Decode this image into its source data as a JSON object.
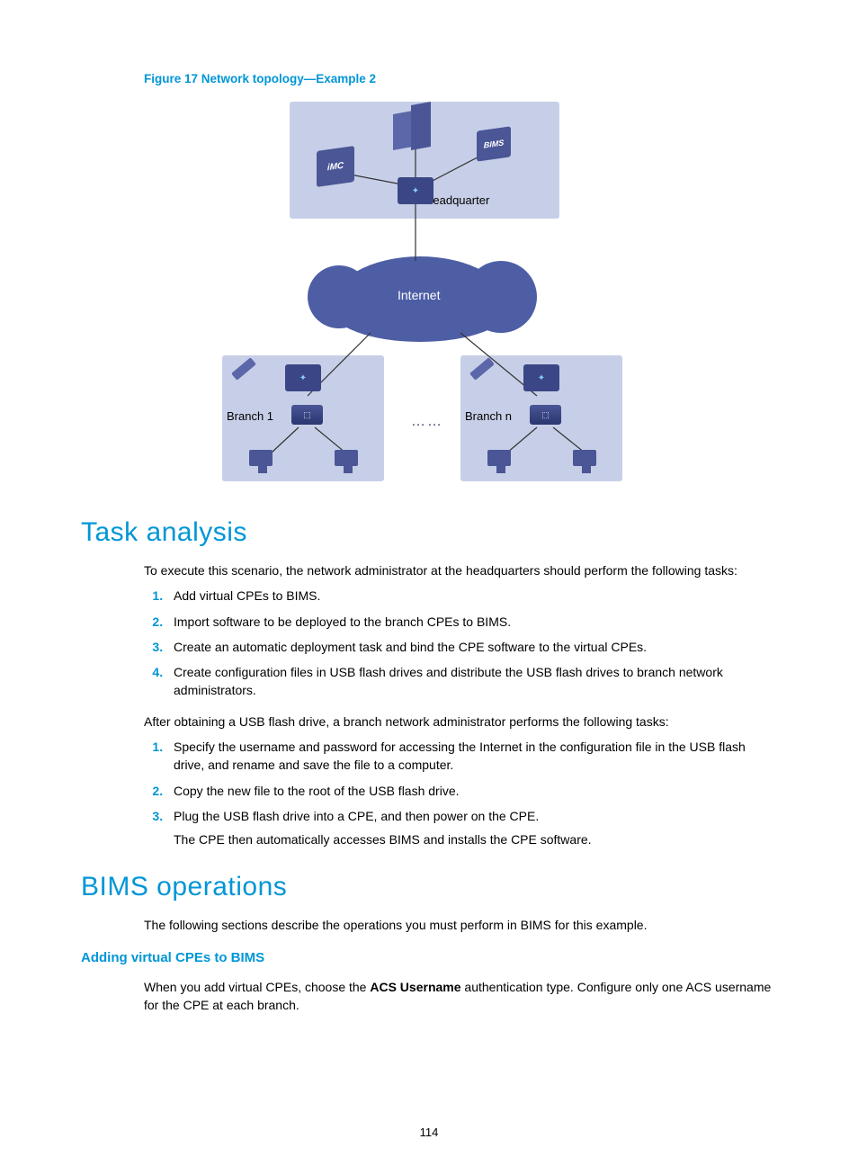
{
  "figure": {
    "caption": "Figure 17 Network topology—Example 2",
    "labels": {
      "hq": "Headquarter",
      "internet": "Internet",
      "branch1": "Branch 1",
      "branchn": "Branch n",
      "ellipsis": "……",
      "imc": "iMC",
      "bims": "BIMS"
    }
  },
  "sections": {
    "task_analysis": {
      "heading": "Task analysis",
      "intro": "To execute this scenario, the network administrator at the headquarters should perform the following tasks:",
      "list1": [
        "Add virtual CPEs to BIMS.",
        "Import software to be deployed to the branch CPEs to BIMS.",
        "Create an automatic deployment task and bind the CPE software to the virtual CPEs.",
        "Create configuration files in USB flash drives and distribute the USB flash drives to branch network administrators."
      ],
      "mid": "After obtaining a USB flash drive, a branch network administrator performs the following tasks:",
      "list2": [
        "Specify the username and password for accessing the Internet in the configuration file in the USB flash drive, and rename and save the file to a computer.",
        "Copy the new file to the root of the USB flash drive.",
        "Plug the USB flash drive into a CPE, and then power on the CPE."
      ],
      "list2_note": "The CPE then automatically accesses BIMS and installs the CPE software."
    },
    "bims_ops": {
      "heading": "BIMS operations",
      "intro": "The following sections describe the operations you must perform in BIMS for this example.",
      "sub1_heading": "Adding virtual CPEs to BIMS",
      "sub1_text_pre": "When you add virtual CPEs, choose the ",
      "sub1_bold": "ACS Username",
      "sub1_text_post": " authentication type. Configure only one ACS username for the CPE at each branch."
    }
  },
  "page_number": "114"
}
